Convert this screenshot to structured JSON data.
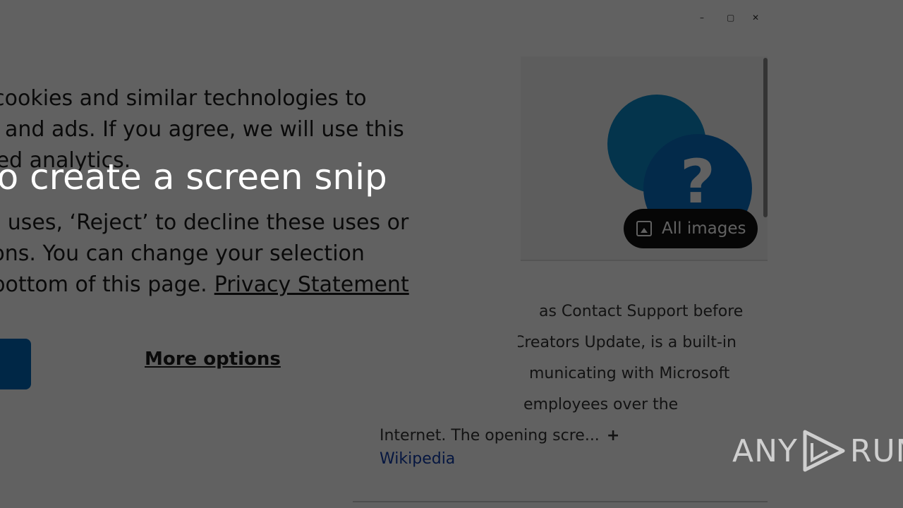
{
  "background": {
    "window_controls": [
      "–",
      "▢",
      "✕"
    ],
    "images_button_label": "All images",
    "wiki_description_lines": [
      "as Contact Support before",
      "Creators Update, is a built-in",
      "municating with Microsoft",
      "employees over the",
      "Internet. The opening scre..."
    ],
    "wiki_expand": "+",
    "wiki_source": "Wikipedia"
  },
  "dialog": {
    "lines": [
      "rs use cookies and similar technologies to",
      "ervices and ads. If you agree, we will use this",
      "ssociated analytics.",
      "",
      "o these uses, ‘Reject’ to decline these uses or",
      "ur options. You can change your selection",
      "at the bottom of this page."
    ],
    "privacy_link": "Privacy Statement",
    "more_options": "More options"
  },
  "title_overlay": "to create a screen snip",
  "watermark": {
    "left": "ANY",
    "right": "RUN"
  },
  "colors": {
    "accent": "#0067b8",
    "overlay": "#000000"
  }
}
